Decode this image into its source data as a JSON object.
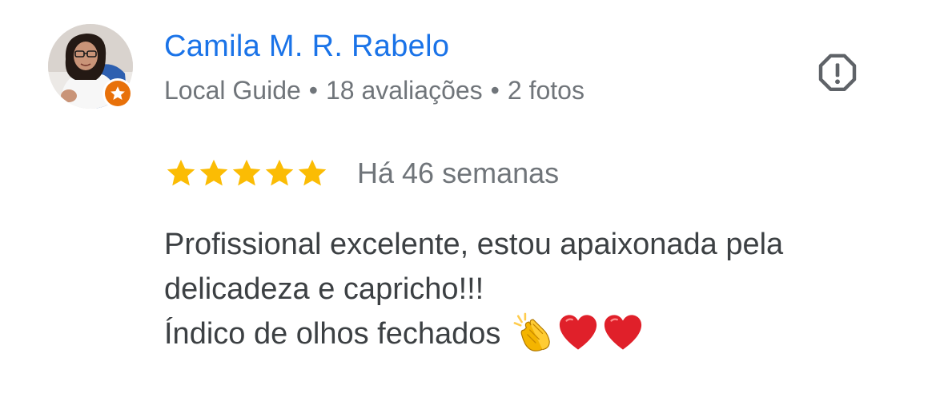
{
  "author": {
    "name": "Camila M. R. Rabelo",
    "badge": "Local Guide",
    "reviews_count": "18 avaliações",
    "photos_count": "2 fotos",
    "separator": "•"
  },
  "review": {
    "rating": 5,
    "rating_max": 5,
    "date": "Há 46 semanas",
    "text_lines": [
      "Profissional excelente, estou apaixonada pela",
      "delicadeza e capricho!!!",
      "Índico de olhos fechados"
    ],
    "emojis": [
      "clapping-hands-emoji",
      "red-heart-emoji",
      "red-heart-emoji"
    ]
  },
  "icons": {
    "report": "report-octagon-icon",
    "guide_badge": "local-guide-star-icon",
    "star": "star-icon"
  },
  "colors": {
    "author_name": "#1a73e8",
    "meta_text": "#70757a",
    "body_text": "#3c4043",
    "star": "#fbbc04",
    "guide_badge": "#e8710a",
    "report_icon": "#5f6368",
    "heart": "#e0202a"
  }
}
